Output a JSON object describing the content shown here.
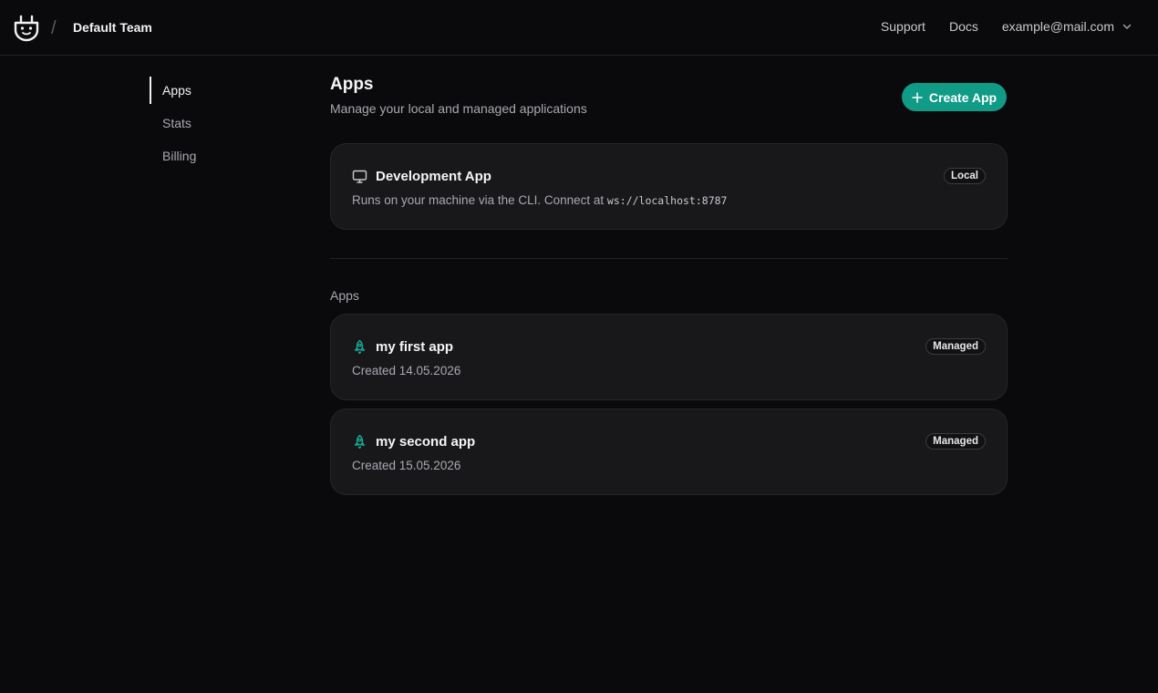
{
  "header": {
    "team_name": "Default Team",
    "separator": "/",
    "nav": {
      "support": "Support",
      "docs": "Docs"
    },
    "user_email": "example@mail.com"
  },
  "sidebar": {
    "items": [
      {
        "label": "Apps",
        "active": true
      },
      {
        "label": "Stats",
        "active": false
      },
      {
        "label": "Billing",
        "active": false
      }
    ]
  },
  "main": {
    "title": "Apps",
    "subtitle": "Manage your local and managed applications",
    "create_button_label": "Create App",
    "dev_app": {
      "name": "Development App",
      "description": "Runs on your machine via the CLI. Connect at",
      "address": "ws://localhost:8787",
      "badge": "Local"
    },
    "section_label": "Apps",
    "apps": [
      {
        "name": "my first app",
        "created": "Created 14.05.2026",
        "badge": "Managed"
      },
      {
        "name": "my second app",
        "created": "Created 15.05.2026",
        "badge": "Managed"
      }
    ]
  },
  "colors": {
    "accent": "#0f9b85",
    "background": "#0a0a0c",
    "card": "#18181b"
  },
  "icons": {
    "logo": "plug-face-icon",
    "dev_app": "monitor-icon",
    "app": "rocket-icon",
    "create": "plus-icon",
    "user_menu": "chevron-down-icon"
  }
}
